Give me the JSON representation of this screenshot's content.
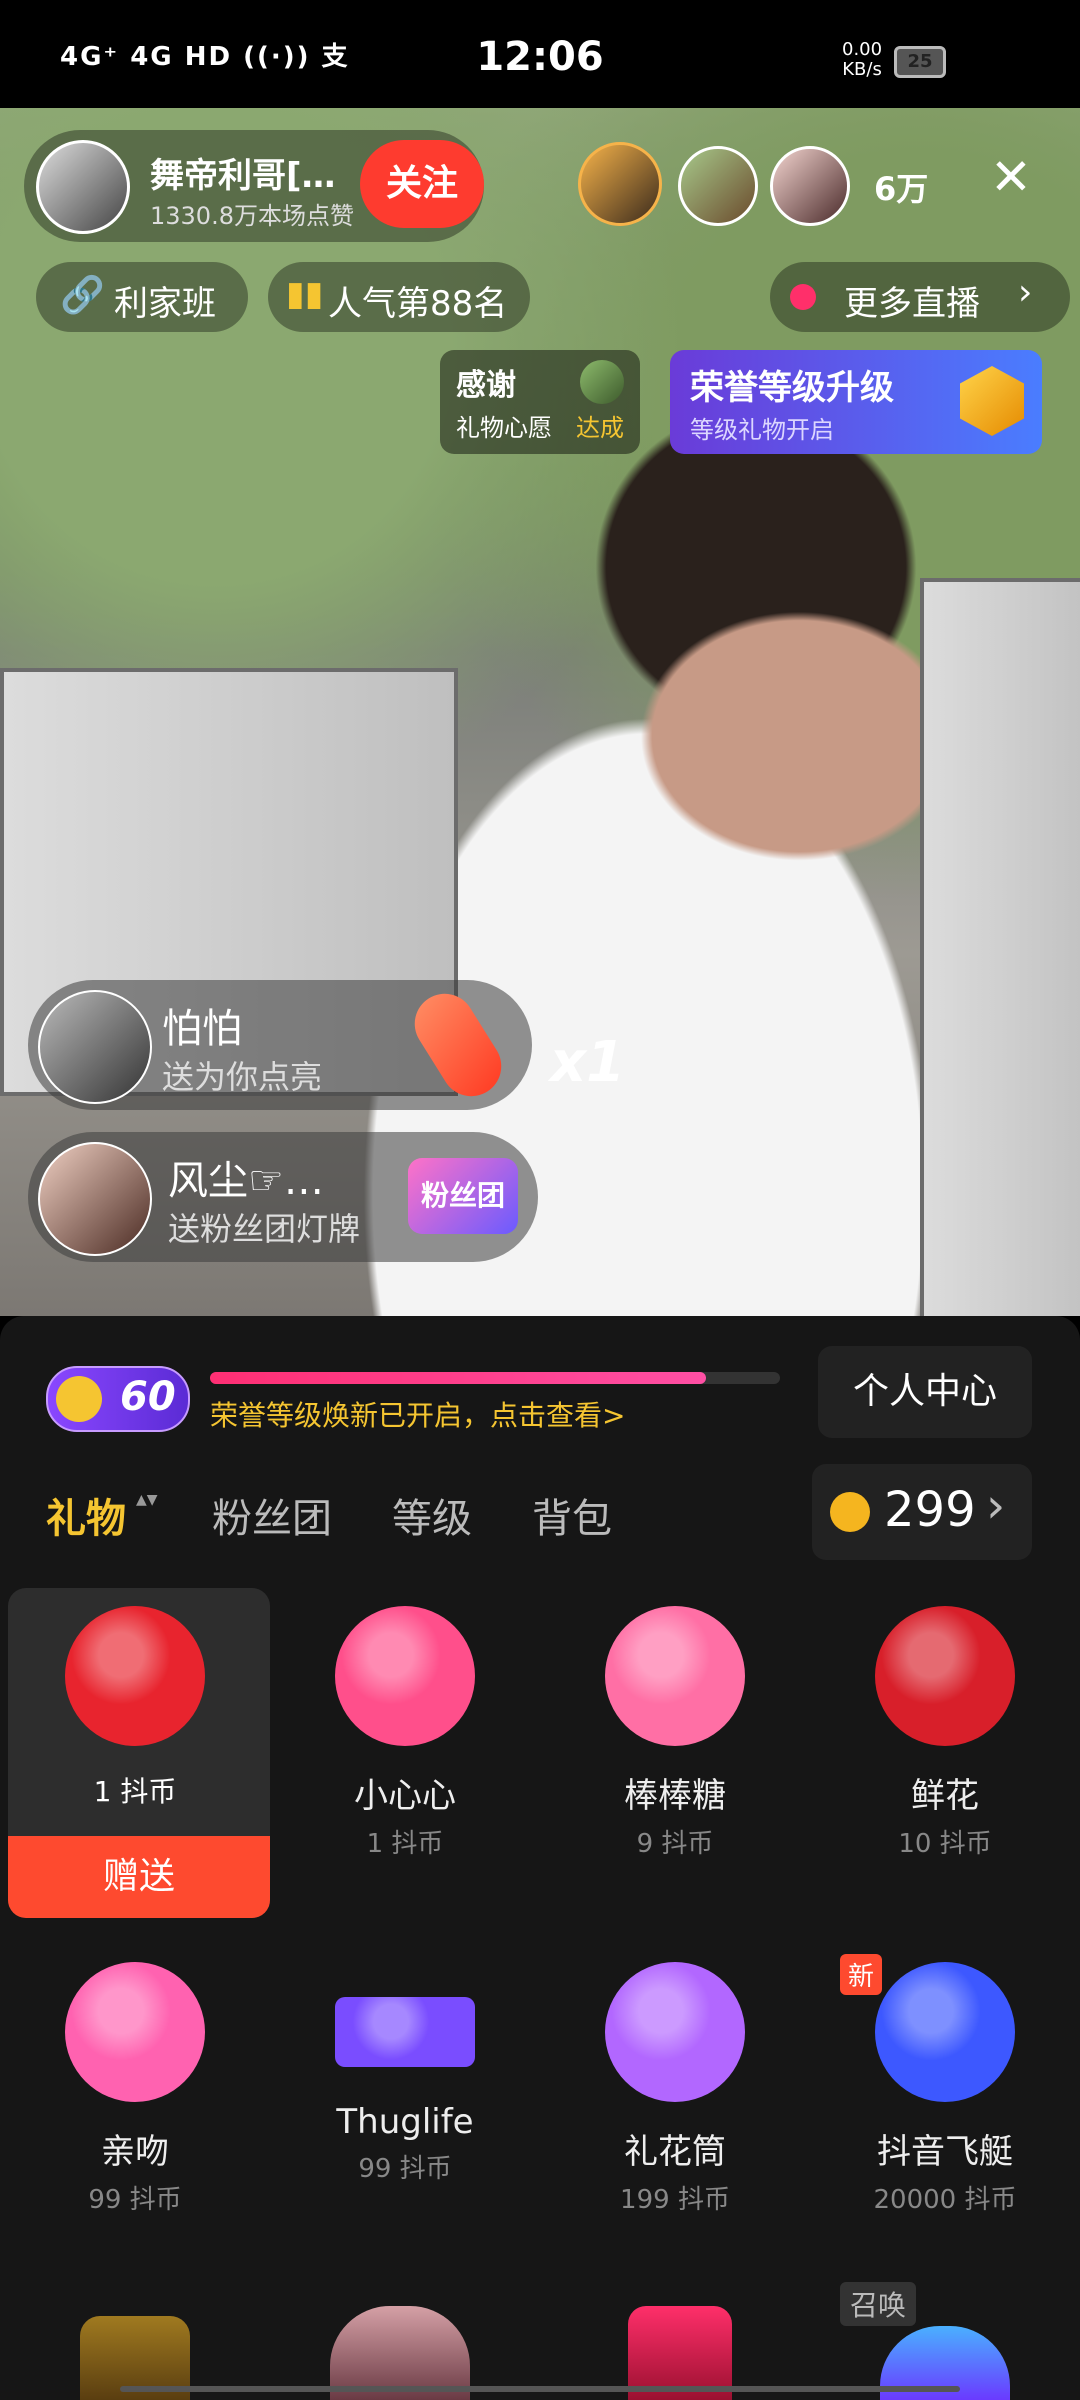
{
  "status_bar": {
    "network": "4G⁺ 4G HD ((·)) 支",
    "time": "12:06",
    "speed_value": "0.00",
    "speed_unit": "KB/s",
    "battery": "25"
  },
  "stream": {
    "host_name": "舞帝利哥[…",
    "likes": "1330.8万本场点赞",
    "follow_label": "关注",
    "viewer_count": "6万",
    "family_label": "利家班",
    "rank_label": "人气第88名",
    "more_live_label": "更多直播",
    "thanks_title": "感谢",
    "thanks_sub": "礼物心愿",
    "thanks_status": "达成",
    "honor_title": "荣誉等级升级",
    "honor_sub": "等级礼物开启",
    "badge_text": "粉丝团"
  },
  "messages": [
    {
      "name": "怕怕",
      "text": "送为你点亮",
      "combo": "x1"
    },
    {
      "name": "风尘☞…",
      "text": "送粉丝团灯牌",
      "badge": "粉丝团"
    }
  ],
  "panel": {
    "level": "60",
    "progress": 0.87,
    "notice": "荣誉等级焕新已开启，点击查看>",
    "personal_center": "个人中心",
    "tabs": [
      "礼物",
      "粉丝团",
      "等级",
      "背包"
    ],
    "active_tab_arrow": "▲▼",
    "coins": "299",
    "send_label": "赠送",
    "new_badge": "新",
    "summon_badge": "召唤"
  },
  "gifts": [
    {
      "name": "",
      "price": "1 抖币",
      "icon": "rose-icon",
      "color": "#e8242e"
    },
    {
      "name": "小心心",
      "price": "1 抖币",
      "icon": "heart-icon",
      "color": "#ff4f8b"
    },
    {
      "name": "棒棒糖",
      "price": "9 抖币",
      "icon": "lollipop-icon",
      "color": "#ff6fa5"
    },
    {
      "name": "鲜花",
      "price": "10 抖币",
      "icon": "bouquet-icon",
      "color": "#d81f2a"
    },
    {
      "name": "亲吻",
      "price": "99 抖币",
      "icon": "kiss-heart-icon",
      "color": "#ff62b0"
    },
    {
      "name": "Thuglife",
      "price": "99 抖币",
      "icon": "pixel-glasses-icon",
      "color": "#7a4dff"
    },
    {
      "name": "礼花筒",
      "price": "199 抖币",
      "icon": "party-popper-icon",
      "color": "#b267ff"
    },
    {
      "name": "抖音飞艇",
      "price": "20000 抖币",
      "icon": "airship-icon",
      "color": "#3d58ff"
    }
  ]
}
